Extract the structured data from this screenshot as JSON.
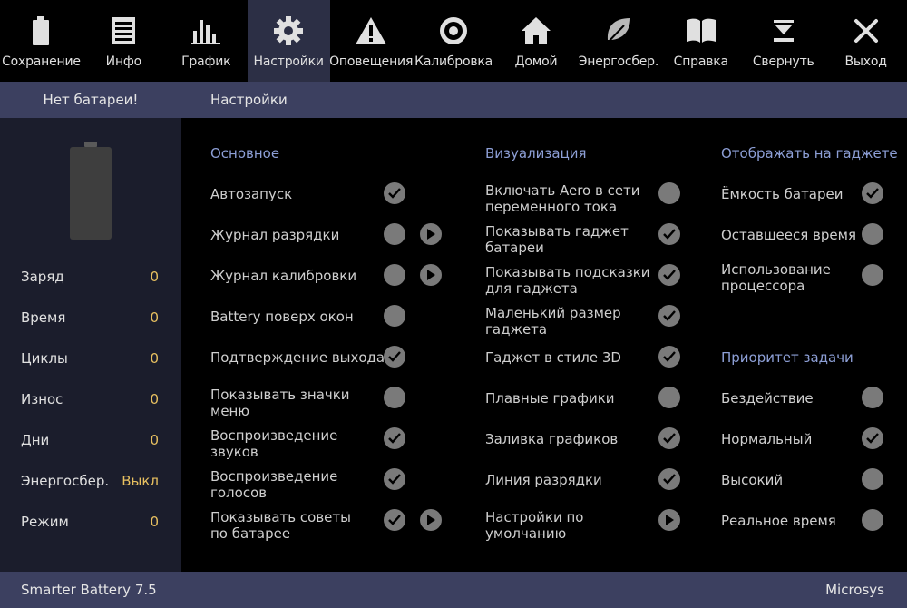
{
  "toolbar": {
    "items": [
      {
        "label": "Сохранение",
        "icon": "battery-icon"
      },
      {
        "label": "Инфо",
        "icon": "document-icon"
      },
      {
        "label": "График",
        "icon": "bar-chart-icon"
      },
      {
        "label": "Настройки",
        "icon": "gear-icon",
        "active": true
      },
      {
        "label": "Оповещения",
        "icon": "warning-icon"
      },
      {
        "label": "Калибровка",
        "icon": "target-icon"
      },
      {
        "label": "Домой",
        "icon": "home-icon"
      },
      {
        "label": "Энергосбер.",
        "icon": "leaf-icon"
      },
      {
        "label": "Справка",
        "icon": "book-icon"
      },
      {
        "label": "Свернуть",
        "icon": "minimize-icon"
      },
      {
        "label": "Выход",
        "icon": "close-icon"
      }
    ]
  },
  "header": {
    "battery_status": "Нет батареи!",
    "title": "Настройки"
  },
  "sidebar": {
    "stats": [
      {
        "label": "Заряд",
        "value": "0"
      },
      {
        "label": "Время",
        "value": "0"
      },
      {
        "label": "Циклы",
        "value": "0"
      },
      {
        "label": "Износ",
        "value": "0"
      },
      {
        "label": "Дни",
        "value": "0"
      },
      {
        "label": "Энергосбер.",
        "value": "Выкл"
      },
      {
        "label": "Режим",
        "value": "0"
      }
    ]
  },
  "settings": {
    "general": {
      "title": "Основное",
      "options": [
        {
          "label": "Автозапуск",
          "checked": true,
          "play": false
        },
        {
          "label": "Журнал разрядки",
          "checked": false,
          "play": true
        },
        {
          "label": "Журнал калибровки",
          "checked": false,
          "play": true
        },
        {
          "label": "Battery поверх окон",
          "checked": false,
          "play": false
        },
        {
          "label": "Подтверждение выхода",
          "checked": true,
          "play": false
        },
        {
          "label": "Показывать значки меню",
          "checked": false,
          "play": false
        },
        {
          "label": "Воспроизведение звуков",
          "checked": true,
          "play": false
        },
        {
          "label": "Воспроизведение голосов",
          "checked": true,
          "play": false
        },
        {
          "label": "Показывать советы по батарее",
          "checked": true,
          "play": true
        }
      ]
    },
    "visualization": {
      "title": "Визуализация",
      "options": [
        {
          "label": "Включать Aero в сети переменного тока",
          "checked": false
        },
        {
          "label": "Показывать гаджет батареи",
          "checked": true
        },
        {
          "label": "Показывать подсказки для гаджета",
          "checked": true
        },
        {
          "label": "Маленький размер гаджета",
          "checked": true
        },
        {
          "label": "Гаджет в стиле 3D",
          "checked": true
        },
        {
          "label": "Плавные графики",
          "checked": false
        },
        {
          "label": "Заливка графиков",
          "checked": true
        },
        {
          "label": "Линия разрядки",
          "checked": true
        },
        {
          "label": "Настройки по умолчанию",
          "play_only": true
        }
      ]
    },
    "gadget": {
      "title": "Отображать на гаджете",
      "options": [
        {
          "label": "Ёмкость батареи",
          "checked": true
        },
        {
          "label": "Оставшееся время",
          "checked": false
        },
        {
          "label": "Использование процессора",
          "checked": false
        }
      ]
    },
    "priority": {
      "title": "Приоритет задачи",
      "options": [
        {
          "label": "Бездействие",
          "checked": false
        },
        {
          "label": "Нормальный",
          "checked": true
        },
        {
          "label": "Высокий",
          "checked": false
        },
        {
          "label": "Реальное время",
          "checked": false
        }
      ]
    }
  },
  "statusbar": {
    "app_version": "Smarter Battery 7.5",
    "vendor": "Microsys"
  },
  "colors": {
    "accent_heading": "#8d9fd6",
    "bar_bg": "#3c4060",
    "sidebar_bg": "#1b1d2c",
    "stat_value": "#e8c060"
  }
}
